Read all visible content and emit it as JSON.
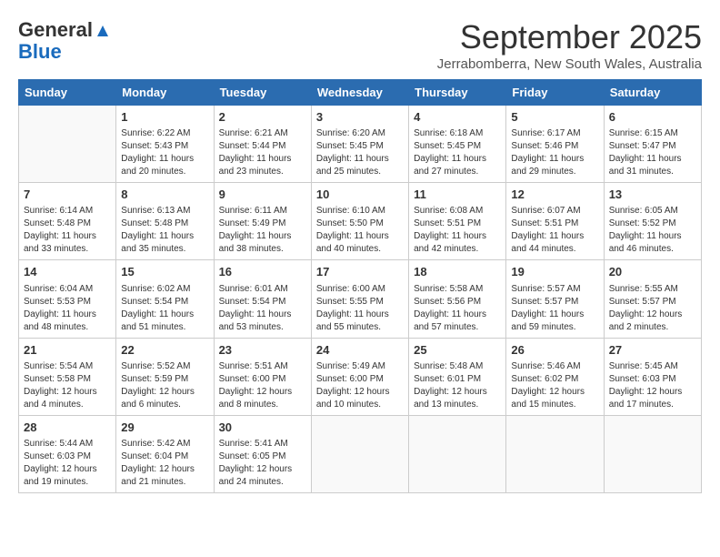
{
  "header": {
    "logo_line1": "General",
    "logo_line2": "Blue",
    "month": "September 2025",
    "location": "Jerrabomberra, New South Wales, Australia"
  },
  "days_of_week": [
    "Sunday",
    "Monday",
    "Tuesday",
    "Wednesday",
    "Thursday",
    "Friday",
    "Saturday"
  ],
  "weeks": [
    [
      {
        "day": "",
        "sunrise": "",
        "sunset": "",
        "daylight": ""
      },
      {
        "day": "1",
        "sunrise": "Sunrise: 6:22 AM",
        "sunset": "Sunset: 5:43 PM",
        "daylight": "Daylight: 11 hours and 20 minutes."
      },
      {
        "day": "2",
        "sunrise": "Sunrise: 6:21 AM",
        "sunset": "Sunset: 5:44 PM",
        "daylight": "Daylight: 11 hours and 23 minutes."
      },
      {
        "day": "3",
        "sunrise": "Sunrise: 6:20 AM",
        "sunset": "Sunset: 5:45 PM",
        "daylight": "Daylight: 11 hours and 25 minutes."
      },
      {
        "day": "4",
        "sunrise": "Sunrise: 6:18 AM",
        "sunset": "Sunset: 5:45 PM",
        "daylight": "Daylight: 11 hours and 27 minutes."
      },
      {
        "day": "5",
        "sunrise": "Sunrise: 6:17 AM",
        "sunset": "Sunset: 5:46 PM",
        "daylight": "Daylight: 11 hours and 29 minutes."
      },
      {
        "day": "6",
        "sunrise": "Sunrise: 6:15 AM",
        "sunset": "Sunset: 5:47 PM",
        "daylight": "Daylight: 11 hours and 31 minutes."
      }
    ],
    [
      {
        "day": "7",
        "sunrise": "Sunrise: 6:14 AM",
        "sunset": "Sunset: 5:48 PM",
        "daylight": "Daylight: 11 hours and 33 minutes."
      },
      {
        "day": "8",
        "sunrise": "Sunrise: 6:13 AM",
        "sunset": "Sunset: 5:48 PM",
        "daylight": "Daylight: 11 hours and 35 minutes."
      },
      {
        "day": "9",
        "sunrise": "Sunrise: 6:11 AM",
        "sunset": "Sunset: 5:49 PM",
        "daylight": "Daylight: 11 hours and 38 minutes."
      },
      {
        "day": "10",
        "sunrise": "Sunrise: 6:10 AM",
        "sunset": "Sunset: 5:50 PM",
        "daylight": "Daylight: 11 hours and 40 minutes."
      },
      {
        "day": "11",
        "sunrise": "Sunrise: 6:08 AM",
        "sunset": "Sunset: 5:51 PM",
        "daylight": "Daylight: 11 hours and 42 minutes."
      },
      {
        "day": "12",
        "sunrise": "Sunrise: 6:07 AM",
        "sunset": "Sunset: 5:51 PM",
        "daylight": "Daylight: 11 hours and 44 minutes."
      },
      {
        "day": "13",
        "sunrise": "Sunrise: 6:05 AM",
        "sunset": "Sunset: 5:52 PM",
        "daylight": "Daylight: 11 hours and 46 minutes."
      }
    ],
    [
      {
        "day": "14",
        "sunrise": "Sunrise: 6:04 AM",
        "sunset": "Sunset: 5:53 PM",
        "daylight": "Daylight: 11 hours and 48 minutes."
      },
      {
        "day": "15",
        "sunrise": "Sunrise: 6:02 AM",
        "sunset": "Sunset: 5:54 PM",
        "daylight": "Daylight: 11 hours and 51 minutes."
      },
      {
        "day": "16",
        "sunrise": "Sunrise: 6:01 AM",
        "sunset": "Sunset: 5:54 PM",
        "daylight": "Daylight: 11 hours and 53 minutes."
      },
      {
        "day": "17",
        "sunrise": "Sunrise: 6:00 AM",
        "sunset": "Sunset: 5:55 PM",
        "daylight": "Daylight: 11 hours and 55 minutes."
      },
      {
        "day": "18",
        "sunrise": "Sunrise: 5:58 AM",
        "sunset": "Sunset: 5:56 PM",
        "daylight": "Daylight: 11 hours and 57 minutes."
      },
      {
        "day": "19",
        "sunrise": "Sunrise: 5:57 AM",
        "sunset": "Sunset: 5:57 PM",
        "daylight": "Daylight: 11 hours and 59 minutes."
      },
      {
        "day": "20",
        "sunrise": "Sunrise: 5:55 AM",
        "sunset": "Sunset: 5:57 PM",
        "daylight": "Daylight: 12 hours and 2 minutes."
      }
    ],
    [
      {
        "day": "21",
        "sunrise": "Sunrise: 5:54 AM",
        "sunset": "Sunset: 5:58 PM",
        "daylight": "Daylight: 12 hours and 4 minutes."
      },
      {
        "day": "22",
        "sunrise": "Sunrise: 5:52 AM",
        "sunset": "Sunset: 5:59 PM",
        "daylight": "Daylight: 12 hours and 6 minutes."
      },
      {
        "day": "23",
        "sunrise": "Sunrise: 5:51 AM",
        "sunset": "Sunset: 6:00 PM",
        "daylight": "Daylight: 12 hours and 8 minutes."
      },
      {
        "day": "24",
        "sunrise": "Sunrise: 5:49 AM",
        "sunset": "Sunset: 6:00 PM",
        "daylight": "Daylight: 12 hours and 10 minutes."
      },
      {
        "day": "25",
        "sunrise": "Sunrise: 5:48 AM",
        "sunset": "Sunset: 6:01 PM",
        "daylight": "Daylight: 12 hours and 13 minutes."
      },
      {
        "day": "26",
        "sunrise": "Sunrise: 5:46 AM",
        "sunset": "Sunset: 6:02 PM",
        "daylight": "Daylight: 12 hours and 15 minutes."
      },
      {
        "day": "27",
        "sunrise": "Sunrise: 5:45 AM",
        "sunset": "Sunset: 6:03 PM",
        "daylight": "Daylight: 12 hours and 17 minutes."
      }
    ],
    [
      {
        "day": "28",
        "sunrise": "Sunrise: 5:44 AM",
        "sunset": "Sunset: 6:03 PM",
        "daylight": "Daylight: 12 hours and 19 minutes."
      },
      {
        "day": "29",
        "sunrise": "Sunrise: 5:42 AM",
        "sunset": "Sunset: 6:04 PM",
        "daylight": "Daylight: 12 hours and 21 minutes."
      },
      {
        "day": "30",
        "sunrise": "Sunrise: 5:41 AM",
        "sunset": "Sunset: 6:05 PM",
        "daylight": "Daylight: 12 hours and 24 minutes."
      },
      {
        "day": "",
        "sunrise": "",
        "sunset": "",
        "daylight": ""
      },
      {
        "day": "",
        "sunrise": "",
        "sunset": "",
        "daylight": ""
      },
      {
        "day": "",
        "sunrise": "",
        "sunset": "",
        "daylight": ""
      },
      {
        "day": "",
        "sunrise": "",
        "sunset": "",
        "daylight": ""
      }
    ]
  ]
}
